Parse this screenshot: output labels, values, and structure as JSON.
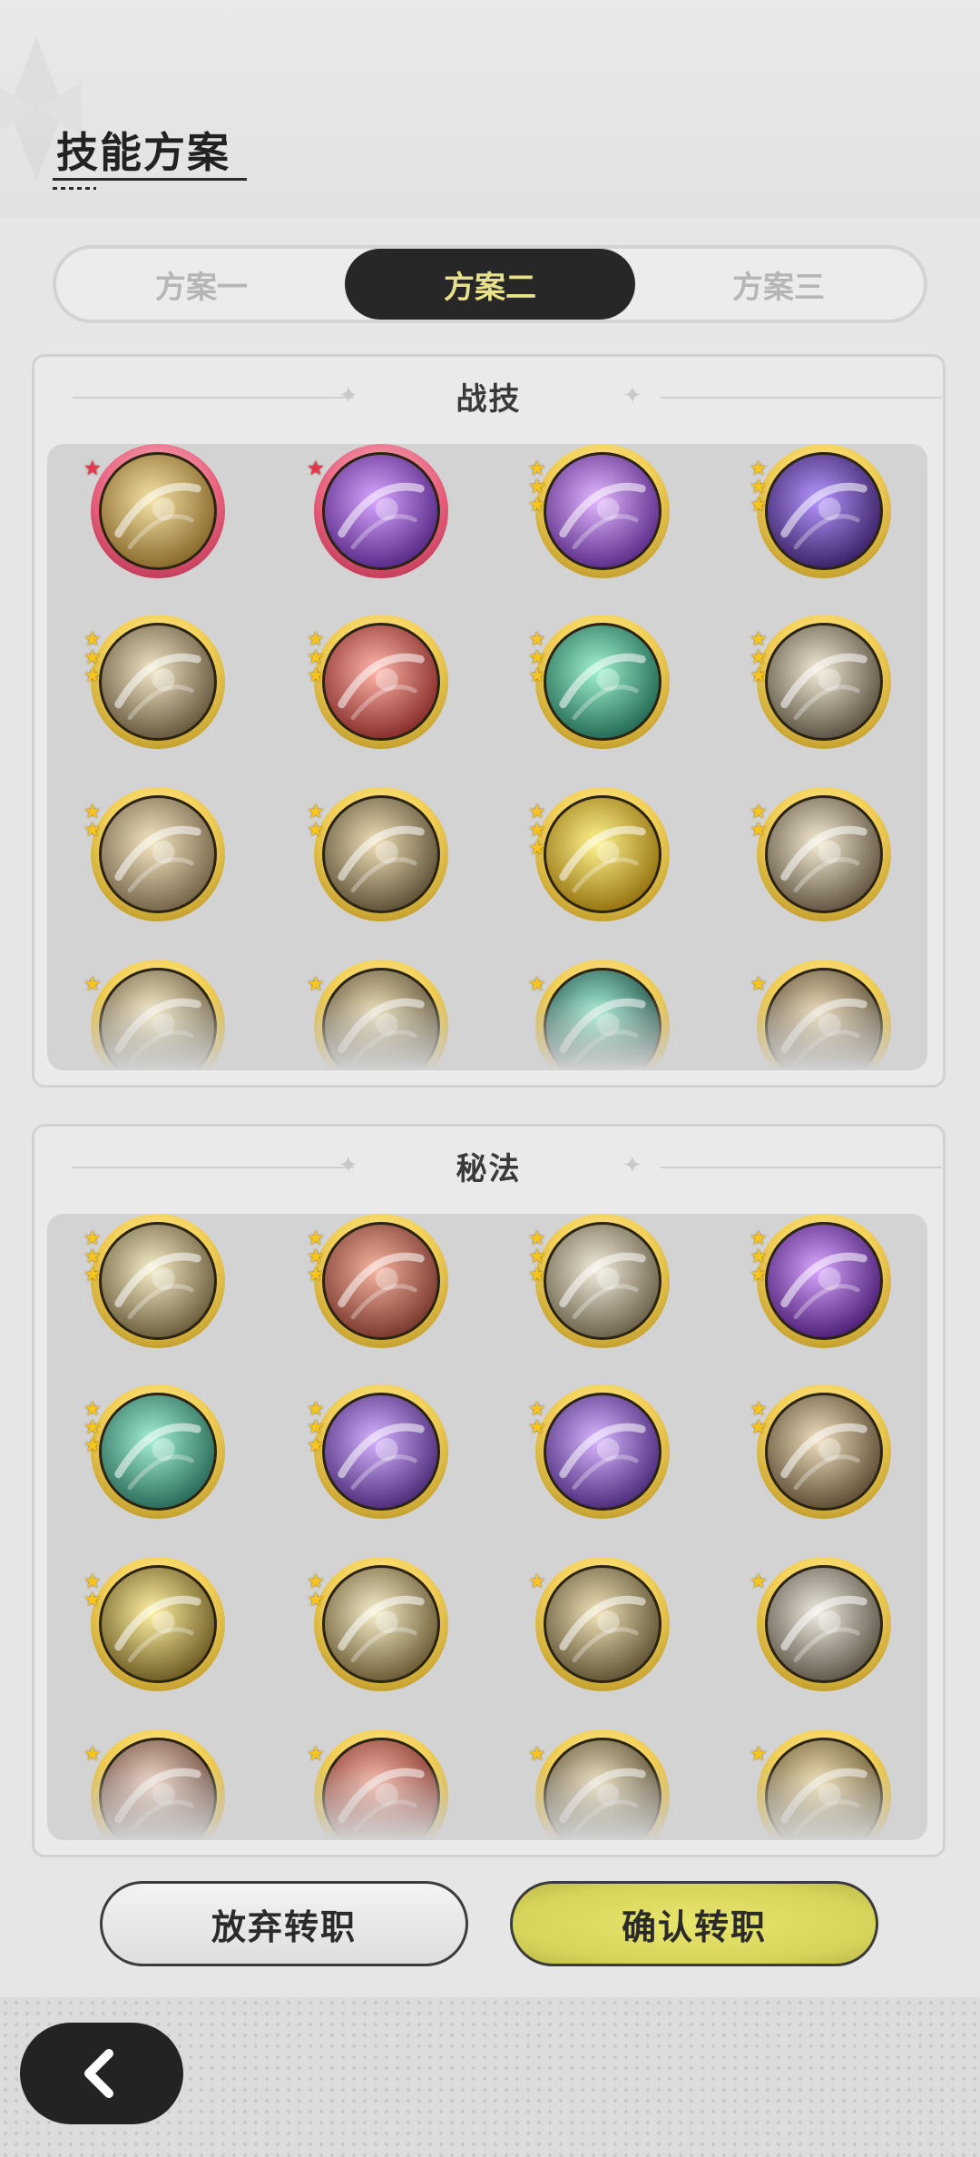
{
  "header": {
    "title": "技能方案"
  },
  "tabs": [
    {
      "label": "方案一",
      "active": false
    },
    {
      "label": "方案二",
      "active": true
    },
    {
      "label": "方案三",
      "active": false
    }
  ],
  "panels": {
    "combat": {
      "title": "战技"
    },
    "arcane": {
      "title": "秘法"
    }
  },
  "combat_skills": [
    {
      "icon": "golden-slash-icon",
      "stars": 1,
      "star_color": "red",
      "ring": "red",
      "c1": "#f6e3a6",
      "c2": "#7a5a1c"
    },
    {
      "icon": "purple-heart-icon",
      "stars": 1,
      "star_color": "red",
      "ring": "red",
      "c1": "#d7a6ff",
      "c2": "#4a1a7a"
    },
    {
      "icon": "purple-orb-icon",
      "stars": 3,
      "star_color": "gold",
      "ring": "gold",
      "c1": "#e2b7ff",
      "c2": "#4b1c7c"
    },
    {
      "icon": "purple-claw-icon",
      "stars": 3,
      "star_color": "gold",
      "ring": "gold",
      "c1": "#b596ff",
      "c2": "#2c1454"
    },
    {
      "icon": "hand-strike-icon",
      "stars": 3,
      "star_color": "gold",
      "ring": "gold",
      "c1": "#f2e6c7",
      "c2": "#55472d"
    },
    {
      "icon": "sword-raise-icon",
      "stars": 3,
      "star_color": "gold",
      "ring": "gold",
      "c1": "#ffb5a8",
      "c2": "#7a1d1d"
    },
    {
      "icon": "teal-arrows-icon",
      "stars": 3,
      "star_color": "gold",
      "ring": "gold",
      "c1": "#9ff3cf",
      "c2": "#145a46"
    },
    {
      "icon": "wind-slash-icon",
      "stars": 3,
      "star_color": "gold",
      "ring": "gold",
      "c1": "#f2e9d6",
      "c2": "#4a4130"
    },
    {
      "icon": "whirlwind-icon",
      "stars": 2,
      "star_color": "gold",
      "ring": "gold",
      "c1": "#f4e6c2",
      "c2": "#66553a"
    },
    {
      "icon": "tear-slash-icon",
      "stars": 2,
      "star_color": "gold",
      "ring": "gold",
      "c1": "#efe0b7",
      "c2": "#4c4028"
    },
    {
      "icon": "gold-shield-up-icon",
      "stars": 3,
      "star_color": "gold",
      "ring": "gold",
      "c1": "#fff48e",
      "c2": "#8a6400"
    },
    {
      "icon": "figure-slash-icon",
      "stars": 2,
      "star_color": "gold",
      "ring": "gold",
      "c1": "#f6ecd4",
      "c2": "#4f4331"
    },
    {
      "icon": "sparkle-blade-icon",
      "stars": 1,
      "star_color": "gold",
      "ring": "gold",
      "c1": "#fbf0cd",
      "c2": "#5d4e30"
    },
    {
      "icon": "spin-ring-icon",
      "stars": 1,
      "star_color": "gold",
      "ring": "gold",
      "c1": "#efe1ba",
      "c2": "#4e4127"
    },
    {
      "icon": "teal-wave-icon",
      "stars": 1,
      "star_color": "gold",
      "ring": "gold",
      "c1": "#a7f2dc",
      "c2": "#113b33"
    },
    {
      "icon": "spike-burst-icon",
      "stars": 1,
      "star_color": "gold",
      "ring": "gold",
      "c1": "#f0dfbb",
      "c2": "#4a3c26"
    }
  ],
  "arcane_skills": [
    {
      "icon": "eye-icon",
      "stars": 3,
      "star_color": "gold",
      "ring": "gold",
      "c1": "#f6edc8",
      "c2": "#5a4c2b"
    },
    {
      "icon": "red-wing-icon",
      "stars": 3,
      "star_color": "gold",
      "ring": "gold",
      "c1": "#f5b3a0",
      "c2": "#6b2a1f"
    },
    {
      "icon": "leaf-crest-icon",
      "stars": 3,
      "star_color": "gold",
      "ring": "gold",
      "c1": "#f3ecdc",
      "c2": "#5b5139"
    },
    {
      "icon": "purple-flame-icon",
      "stars": 3,
      "star_color": "gold",
      "ring": "gold",
      "c1": "#d8a6ff",
      "c2": "#3c0f66"
    },
    {
      "icon": "heal-plus-icon",
      "stars": 3,
      "star_color": "gold",
      "ring": "gold",
      "c1": "#a4f0d5",
      "c2": "#1a5a49"
    },
    {
      "icon": "shadow-figure-icon",
      "stars": 3,
      "star_color": "gold",
      "ring": "gold",
      "c1": "#d5b3ff",
      "c2": "#3d1c6b"
    },
    {
      "icon": "purple-bubble-icon",
      "stars": 2,
      "star_color": "gold",
      "ring": "gold",
      "c1": "#d9b7ff",
      "c2": "#3b1b6d"
    },
    {
      "icon": "dragon-icon",
      "stars": 2,
      "star_color": "gold",
      "ring": "gold",
      "c1": "#efdfbe",
      "c2": "#4b3c24"
    },
    {
      "icon": "glow-figure-icon",
      "stars": 2,
      "star_color": "gold",
      "ring": "gold",
      "c1": "#fff1a3",
      "c2": "#5c4a14"
    },
    {
      "icon": "shield-plus-icon",
      "stars": 2,
      "star_color": "gold",
      "ring": "gold",
      "c1": "#f7efcb",
      "c2": "#5a4a22"
    },
    {
      "icon": "group-icon",
      "stars": 1,
      "star_color": "gold",
      "ring": "gold",
      "c1": "#efe2b8",
      "c2": "#4f4325"
    },
    {
      "icon": "sword-down-icon",
      "stars": 1,
      "star_color": "gold",
      "ring": "gold",
      "c1": "#efeae0",
      "c2": "#4d4638"
    },
    {
      "icon": "heart-shield-icon",
      "stars": 1,
      "star_color": "gold",
      "ring": "gold",
      "c1": "#f2d9c9",
      "c2": "#5b3a2e"
    },
    {
      "icon": "red-rune-icon",
      "stars": 1,
      "star_color": "gold",
      "ring": "gold",
      "c1": "#f7b9aa",
      "c2": "#7a2a1f"
    },
    {
      "icon": "compass-swirl-icon",
      "stars": 1,
      "star_color": "gold",
      "ring": "gold",
      "c1": "#f0e3c1",
      "c2": "#4a3d24"
    },
    {
      "icon": "armor-icon",
      "stars": 1,
      "star_color": "gold",
      "ring": "gold",
      "c1": "#f4e3b5",
      "c2": "#5a4a25"
    }
  ],
  "buttons": {
    "cancel": "放弃转职",
    "confirm": "确认转职"
  },
  "colors": {
    "accent": "#e7e08c",
    "dark": "#272727",
    "gold": "#f4d25a"
  }
}
